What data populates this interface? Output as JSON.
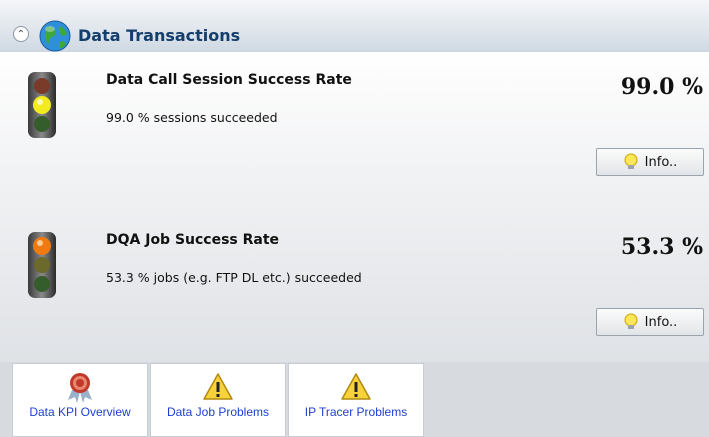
{
  "header": {
    "collapse_icon": "double-chevron-up-icon",
    "globe_icon": "globe-icon",
    "title": "Data Transactions"
  },
  "kpis": [
    {
      "title": "Data Call Session Success Rate",
      "description": "99.0 % sessions succeeded",
      "value": "99.0 %",
      "status": "yellow",
      "info_label": "Info.."
    },
    {
      "title": "DQA Job Success Rate",
      "description": "53.3 % jobs (e.g. FTP DL etc.) succeeded",
      "value": "53.3 %",
      "status": "orange",
      "info_label": "Info.."
    }
  ],
  "tabs": [
    {
      "label": "Data KPI Overview",
      "icon": "award-rosette-icon"
    },
    {
      "label": "Data Job Problems",
      "icon": "warning-icon"
    },
    {
      "label": "IP Tracer Problems",
      "icon": "warning-icon"
    }
  ],
  "colors": {
    "header_title": "#143e6b",
    "tab_link": "#1d3fd0",
    "light_yellow": "#e8e020",
    "light_orange": "#f07a10"
  }
}
